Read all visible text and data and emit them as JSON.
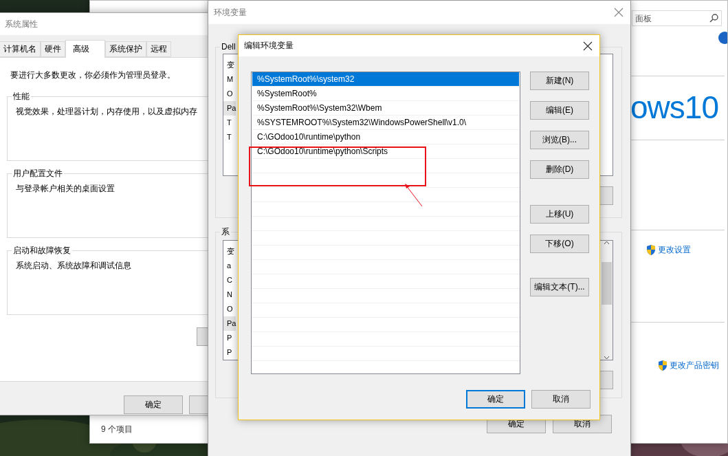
{
  "control_panel": {
    "search": {
      "placeholder": "面板"
    },
    "brand": "ows10",
    "links": [
      "更改设置",
      "更改产品密钥"
    ],
    "status_bar": "9 个项目"
  },
  "system_properties": {
    "title": "系统属性",
    "tabs": [
      {
        "label": "计算机名",
        "selected": false
      },
      {
        "label": "硬件",
        "selected": false
      },
      {
        "label": "高级",
        "selected": true
      },
      {
        "label": "系统保护",
        "selected": false
      },
      {
        "label": "远程",
        "selected": false
      }
    ],
    "notice": "要进行大多数更改，你必须作为管理员登录。",
    "groups": [
      {
        "title": "性能",
        "description": "视觉效果，处理器计划，内存使用，以及虚拟内存"
      },
      {
        "title": "用户配置文件",
        "description": "与登录帐户相关的桌面设置"
      },
      {
        "title": "启动和故障恢复",
        "description": "系统启动、系统故障和调试信息"
      }
    ],
    "buttons": [
      "确定"
    ]
  },
  "environment_variables": {
    "title": "环境变量",
    "user_group": {
      "title": "Dell",
      "header": "变",
      "rows": [
        {
          "text": "M",
          "selected": false
        },
        {
          "text": "O",
          "selected": false
        },
        {
          "text": "Pa",
          "selected": true
        },
        {
          "text": "T",
          "selected": false
        },
        {
          "text": "T",
          "selected": false
        }
      ]
    },
    "system_group": {
      "title": "系",
      "header": "变",
      "rows": [
        {
          "text": "a",
          "selected": false
        },
        {
          "text": "C",
          "selected": false
        },
        {
          "text": "N",
          "selected": false
        },
        {
          "text": "O",
          "selected": false
        },
        {
          "text": "Pa",
          "selected": true
        },
        {
          "text": "P",
          "selected": false
        },
        {
          "text": "P",
          "selected": false
        }
      ]
    },
    "buttons": [
      "确定",
      "取消"
    ]
  },
  "edit_dialog": {
    "title": "编辑环境变量",
    "entries": [
      {
        "text": "%SystemRoot%\\system32",
        "selected": true
      },
      {
        "text": "%SystemRoot%",
        "selected": false
      },
      {
        "text": "%SystemRoot%\\System32\\Wbem",
        "selected": false
      },
      {
        "text": "%SYSTEMROOT%\\System32\\WindowsPowerShell\\v1.0\\",
        "selected": false
      },
      {
        "text": "C:\\GOdoo10\\runtime\\python",
        "selected": false
      },
      {
        "text": "C:\\GOdoo10\\runtime\\python\\Scripts",
        "selected": false
      }
    ],
    "side_buttons": [
      [
        "新建(N)",
        "编辑(E)",
        "浏览(B)...",
        "删除(D)"
      ],
      [
        "上移(U)",
        "下移(O)"
      ],
      [
        "编辑文本(T)..."
      ]
    ],
    "buttons": [
      {
        "label": "确定",
        "default": true
      },
      {
        "label": "取消",
        "default": false
      }
    ]
  }
}
